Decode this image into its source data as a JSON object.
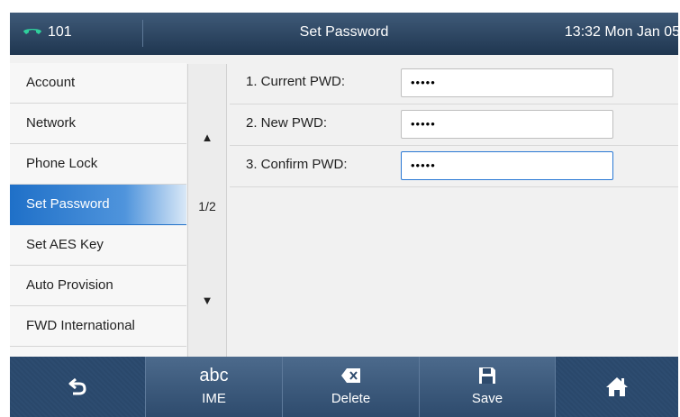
{
  "topbar": {
    "account": "101",
    "title": "Set Password",
    "datetime": "13:32 Mon Jan 05"
  },
  "menu": {
    "items": [
      "Account",
      "Network",
      "Phone Lock",
      "Set Password",
      "Set AES Key",
      "Auto Provision",
      "FWD International"
    ],
    "active_index": 3
  },
  "pager": {
    "page": "1/2",
    "up_icon": "triangle-up-icon",
    "down_icon": "triangle-down-icon"
  },
  "form": {
    "fields": [
      {
        "label": "1. Current PWD:",
        "value": "•••••"
      },
      {
        "label": "2. New PWD:",
        "value": "•••••"
      },
      {
        "label": "3. Confirm PWD:",
        "value": "•••••"
      }
    ]
  },
  "softkeys": {
    "ime_glyph": "abc",
    "ime_label": "IME",
    "delete_label": "Delete",
    "save_label": "Save"
  },
  "colors": {
    "accent": "#1f70c8",
    "bar": "#2d4c70",
    "phone_icon": "#2fcf9c"
  }
}
